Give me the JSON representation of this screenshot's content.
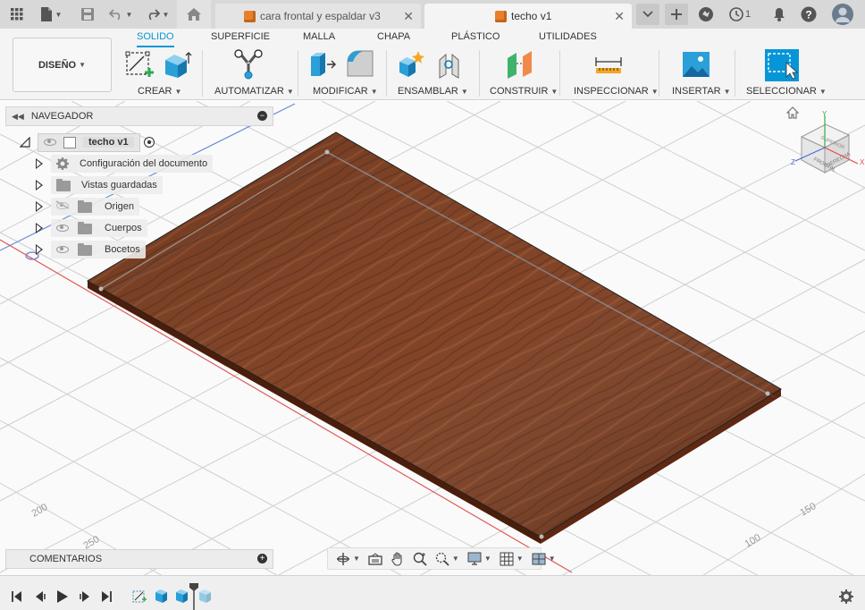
{
  "tabs": [
    {
      "label": "cara frontal y espaldar v3",
      "active": false
    },
    {
      "label": "techo v1",
      "active": true
    }
  ],
  "topbar": {
    "notification_count": "1"
  },
  "design_button": {
    "label": "DISEÑO"
  },
  "ribbon_tabs": [
    "SOLIDO",
    "SUPERFICIE",
    "MALLA",
    "CHAPA",
    "PLÁSTICO",
    "UTILIDADES"
  ],
  "active_ribbon_tab": "SOLIDO",
  "groups": [
    "CREAR",
    "AUTOMATIZAR",
    "MODIFICAR",
    "ENSAMBLAR",
    "CONSTRUIR",
    "INSPECCIONAR",
    "INSERTAR",
    "SELECCIONAR"
  ],
  "navigator": {
    "title": "NAVEGADOR",
    "root": "techo v1",
    "items": [
      {
        "label": "Configuración del documento",
        "icon": "gear-icon"
      },
      {
        "label": "Vistas guardadas",
        "icon": "folder-icon"
      },
      {
        "label": "Origen",
        "icon": "folder-icon",
        "hidden": true
      },
      {
        "label": "Cuerpos",
        "icon": "folder-icon"
      },
      {
        "label": "Bocetos",
        "icon": "folder-icon"
      }
    ]
  },
  "comments": {
    "title": "COMENTARIOS"
  },
  "viewcube": {
    "top": "SUPERIOR",
    "front": "FRONTAL",
    "right": "DERECHA",
    "axis_x": "X",
    "axis_y": "Y",
    "axis_z": "Z"
  },
  "grid_labels": [
    "200",
    "250",
    "150",
    "100"
  ],
  "colors": {
    "accent": "#0696d7",
    "wood": "#7a3a1c",
    "tab_active_bg": "#f4f4f4",
    "topbar_bg": "#d8d8d8"
  }
}
